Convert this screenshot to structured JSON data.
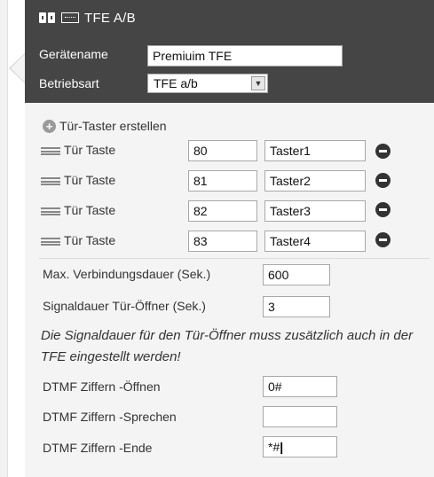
{
  "header": {
    "title": "TFE A/B",
    "device_name_label": "Gerätename",
    "device_name_value": "Premiuim TFE",
    "mode_label": "Betriebsart",
    "mode_value": "TFE a/b"
  },
  "keys": {
    "create_label": "Tür-Taster erstellen",
    "items": [
      {
        "label": "Tür Taste",
        "number": "80",
        "name": "Taster1"
      },
      {
        "label": "Tür Taste",
        "number": "81",
        "name": "Taster2"
      },
      {
        "label": "Tür Taste",
        "number": "82",
        "name": "Taster3"
      },
      {
        "label": "Tür Taste",
        "number": "83",
        "name": "Taster4"
      }
    ]
  },
  "settings": {
    "max_duration_label": "Max. Verbindungsdauer (Sek.)",
    "max_duration_value": "600",
    "signal_duration_label": "Signaldauer Tür-Öffner (Sek.)",
    "signal_duration_value": "3",
    "note": "Die Signaldauer für den Tür-Öffner muss zusätzlich auch in der TFE eingestellt werden!",
    "dtmf_open_label": "DTMF Ziffern -Öffnen",
    "dtmf_open_value": "0#",
    "dtmf_speak_label": "DTMF Ziffern -Sprechen",
    "dtmf_speak_value": "",
    "dtmf_end_label": "DTMF Ziffern -Ende",
    "dtmf_end_value": "*#"
  },
  "colors": {
    "header_bg": "#454545",
    "panel_bg": "#f4f4f4"
  }
}
